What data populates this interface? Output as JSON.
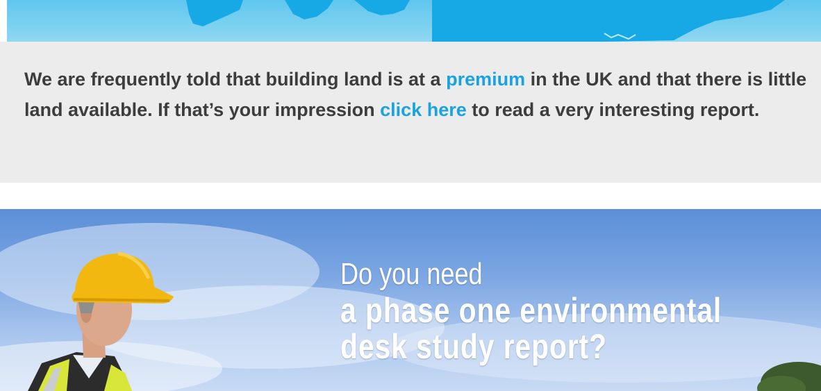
{
  "info": {
    "text_before_premium": "We are frequently told that building land is at a ",
    "premium_link": "premium",
    "text_after_premium": " in the UK and that there is little land available. If that’s your impression ",
    "click_here_link": "click here",
    "text_after_click": " to read a very interesting report."
  },
  "hero": {
    "line1": "Do you need",
    "line2": "a phase one environmental",
    "line3": "desk study report?"
  },
  "colors": {
    "link": "#1aa3df",
    "body_text": "#3d3d3d",
    "panel_bg": "#ececec",
    "map_sea": "#5fc6ee",
    "map_land": "#17a9e6"
  }
}
